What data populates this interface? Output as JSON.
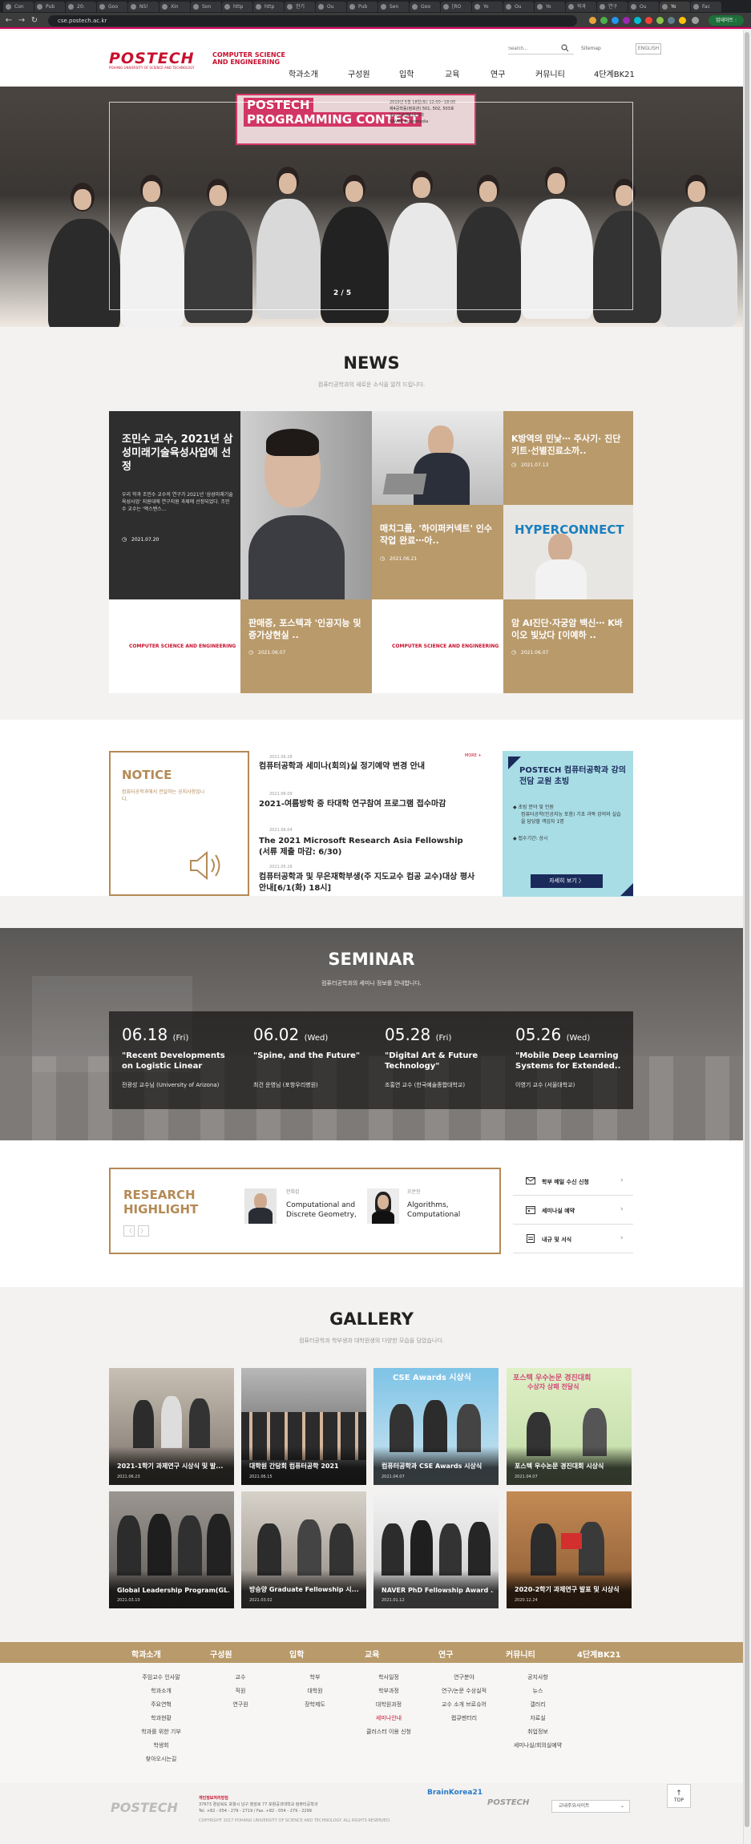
{
  "browser": {
    "tabs": [
      "Con",
      "Pub",
      "20:",
      "Goo",
      "NS!",
      "Xin",
      "Son",
      "http",
      "http",
      "한기",
      "Ou",
      "Pub",
      "Sen",
      "Goo",
      "[RO",
      "Yo",
      "Ou",
      "Yo",
      "학과",
      "연구",
      "Ou",
      "Yo",
      "Fac"
    ],
    "address": "cse.postech.ac.kr",
    "update_label": "업데이트 :"
  },
  "header": {
    "logo": "POSTECH",
    "logo_sub": "POHANG UNIVERSITY OF SCIENCE AND TECHNOLOGY",
    "dept_line1": "COMPUTER SCIENCE",
    "dept_line2": "AND ENGINEERING",
    "search_placeholder": "Search...",
    "sitemap": "Sitemap",
    "english": "ENGLISH",
    "nav": [
      "학과소개",
      "구성원",
      "입학",
      "교육",
      "연구",
      "커뮤니티",
      "4단계BK21"
    ]
  },
  "hero": {
    "banner_line1": "POSTECH",
    "banner_line2": "PROGRAMMING CONTEST",
    "banner_info": [
      "2019년 5월 18일(토) 12:00~18:00",
      "제4공학동(정보관) 501, 502, 503호",
      "포스텍 컴퓨터공학과",
      "NAVER  Bingomedia"
    ],
    "indicator": "2 / 5"
  },
  "news": {
    "title": "NEWS",
    "subtitle": "컴퓨터공학과의 새로운 소식을 알려 드립니다.",
    "items": [
      {
        "title": "조민수 교수, 2021년 삼성미래기술육성사업에 선정",
        "desc": "우리 학과 조민수 교수의 연구가 2021년 '삼성미래기술육성사업' 지원대에 연구지원 과제에 선정되었다. 조민수 교수는 '엑스밴스...",
        "date": "2021.07.20"
      },
      {
        "title": "K방역의 민낯⋯ 주사기· 진단키트·선별진료소까..",
        "date": "2021.07.13"
      },
      {
        "title": "매치그룹, '하이퍼커넥트' 인수작업 완료⋯아..",
        "date": "2021.06.21"
      },
      {
        "title": "판매중, 포스텍과 '인공지능 및 증가상현실 ..",
        "date": "2021.06.07"
      },
      {
        "title": "암 AI진단·자궁암 백신⋯ K바이오 빛났다 [이예하 ..",
        "date": "2021.06.07"
      }
    ],
    "cse_label": "COMPUTER SCIENCE AND ENGINEERING",
    "hyperconnect": "HYPERCONNECT"
  },
  "notice": {
    "title": "NOTICE",
    "desc": "컴퓨터공학과에서 전달하는 공지사항입니다.",
    "more": "MORE +",
    "items": [
      {
        "date": "2021.06.28",
        "text": "컴퓨터공학과 세미나(회의)실 정기예약 변경 안내"
      },
      {
        "date": "2021.06.09",
        "text": "2021-여름방학 중 타대학 연구참여 프로그램 접수마감"
      },
      {
        "date": "2021.06.04",
        "text": "The 2021 Microsoft Research Asia Fellowship (서류 제출 마감: 6/30)"
      },
      {
        "date": "2021.05.26",
        "text": "컴퓨터공학과 및 무은재학부생(주 지도교수 컴공 교수)대상 평사 안내[6/1(화) 18시]"
      }
    ]
  },
  "ad": {
    "title": "POSTECH 컴퓨터공학과 강의 전담 교원 초빙",
    "text1": "초빙 분야 및 인원",
    "text2": "컴퓨터공학(인공지능 포함) 기초 과목 강의와 실습을 담당할 객임자 1명",
    "text3": "접수기간: 상시",
    "button": "자세히 보기 〉"
  },
  "seminar": {
    "title": "SEMINAR",
    "subtitle": "컴퓨터공학과의 세미나 정보를 안내합니다.",
    "items": [
      {
        "date": "06.18",
        "day": "(Fri)",
        "title": "\"Recent Developments on Logistic Linear",
        "speaker": "전광성 교수님 (University of Arizona)"
      },
      {
        "date": "06.02",
        "day": "(Wed)",
        "title": "\"Spine, and the Future\"",
        "speaker": "최건 운영님 (포항우리병원)"
      },
      {
        "date": "05.28",
        "day": "(Fri)",
        "title": "\"Digital Art & Future Technology\"",
        "speaker": "조홍연 교수 (한국예술종합대학교)"
      },
      {
        "date": "05.26",
        "day": "(Wed)",
        "title": "\"Mobile Deep Learning Systems for Extended..",
        "speaker": "이영기 교수 (서울대학교)"
      }
    ]
  },
  "research": {
    "title_line1": "RESEARCH",
    "title_line2": "HIGHLIGHT",
    "prev": "〈",
    "next": "〉",
    "items": [
      {
        "name": "안희갑",
        "area": "Computational and Discrete Geometry,"
      },
      {
        "name": "오은진",
        "area": "Algorithms, Computational"
      }
    ]
  },
  "quick_links": [
    "학부 메일 수신 신청",
    "세미나실 예약",
    "내규 및 서식"
  ],
  "gallery": {
    "title": "GALLERY",
    "subtitle": "컴퓨터공학과 학부생과 대학원생의 다양한 모습을 담았습니다.",
    "items": [
      {
        "title": "2021-1학기 과제연구 시상식 및 발...",
        "date": "2021.06.23"
      },
      {
        "title": "대학원 간담회 컴퓨터공학 2021",
        "date": "2021.06.15"
      },
      {
        "title": "컴퓨터공학과 CSE Awards 시상식",
        "date": "2021.04.07"
      },
      {
        "title": "포스텍 우수논문 경진대회 시상식",
        "date": "2021.04.07"
      },
      {
        "title": "Global Leadership Program(GL...",
        "date": "2021.03.10"
      },
      {
        "title": "방승양 Graduate Fellowship 시...",
        "date": "2021.03.02"
      },
      {
        "title": "NAVER PhD Fellowship Award ...",
        "date": "2021.01.12"
      },
      {
        "title": "2020-2학기 과제연구 발표 및 시상식",
        "date": "2020.12.24"
      }
    ],
    "overlay_text": {
      "awards": "CSE Awards 시상식",
      "paper": "포스텍 우수논문 경진대회",
      "paper2": "수상자 상패 전달식"
    }
  },
  "footer": {
    "nav": [
      "학과소개",
      "구성원",
      "입학",
      "교육",
      "연구",
      "커뮤니티",
      "4단계BK21"
    ],
    "cols": [
      [
        "주임교수 인사말",
        "학과소개",
        "주요연혁",
        "학과현황",
        "학과를 위한 기부",
        "학생회",
        "찾아오시는길"
      ],
      [
        "교수",
        "직원",
        "연구원"
      ],
      [
        "학부",
        "대학원",
        "장학제도"
      ],
      [
        "학사일정",
        "학부과정",
        "대학원과정",
        "세미나안내",
        "클러스터 이용 신청"
      ],
      [
        "연구분야",
        "연구/논문 수상실적",
        "교수 소개 브로슈어",
        "랩큐멘터리"
      ],
      [
        "공지사항",
        "뉴스",
        "갤러리",
        "자료실",
        "취업정보",
        "세미나실/회의실예약"
      ],
      []
    ],
    "logo": "POSTECH",
    "addr_title": "개인정보처리방침",
    "addr1": "37673 경상북도 포항시 남구 청암로 77 포항공과대학교 컴퓨터공학과",
    "addr2": "Tel. +82 - 054 - 279 - 2719 / Fax. +82 - 054 - 279 - 2299",
    "copyright": "COPYRIGHT 2017 POHANG UNIVERSITY OF SCIENCE AND TECHNOLOGY. ALL RIGHTS RESERVED.",
    "bk21": "BrainKorea21",
    "postech_ai": "POSTECH",
    "family_site": "교내주요사이트",
    "top": "TOP"
  }
}
